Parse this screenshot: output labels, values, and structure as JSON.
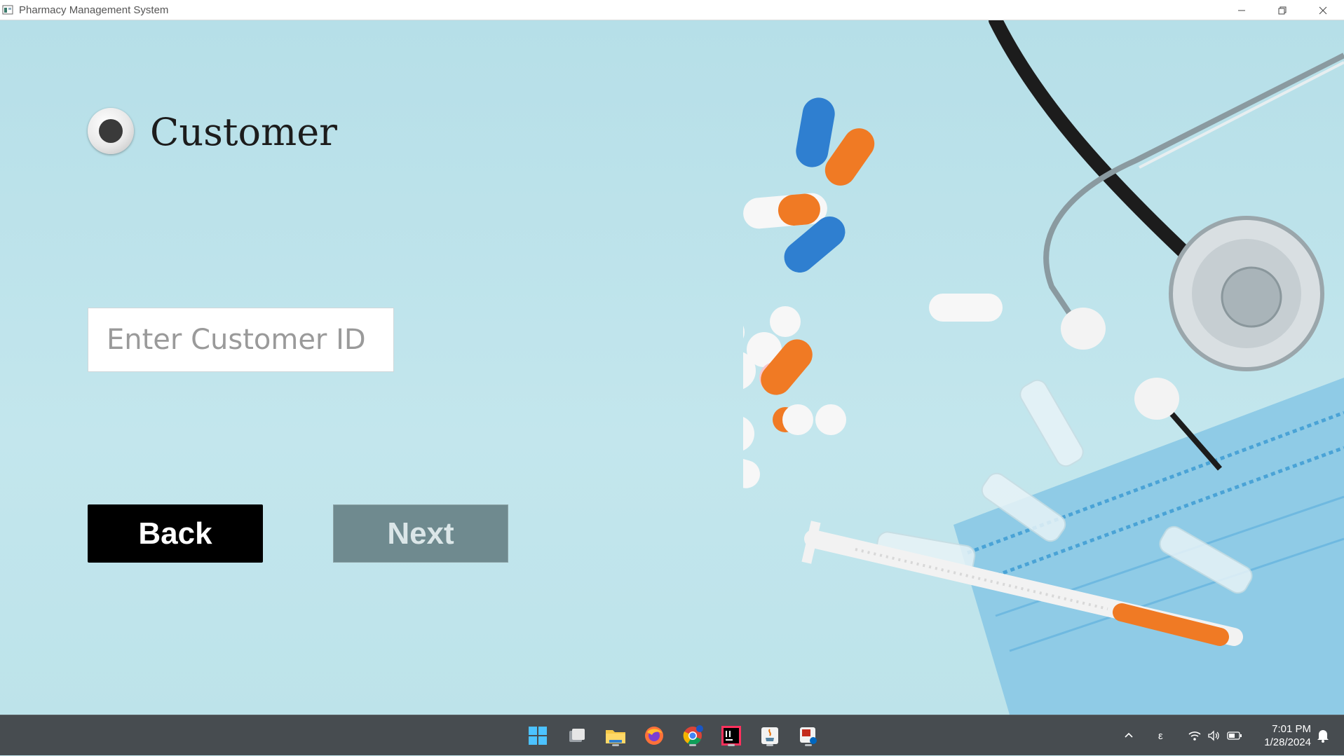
{
  "window": {
    "title": "Pharmacy Management System"
  },
  "form": {
    "radio_label": "Customer",
    "radio_selected": true,
    "id_input": {
      "value": "",
      "placeholder": "Enter Customer ID"
    },
    "back_label": "Back",
    "next_label": "Next"
  },
  "taskbar": {
    "pinned": [
      "windows-start-icon",
      "task-view-icon",
      "file-explorer-icon",
      "firefox-icon",
      "chrome-icon",
      "intellij-icon",
      "java-icon",
      "snipping-tool-icon"
    ],
    "tray_lang": "ε",
    "time": "7:01 PM",
    "date": "1/28/2024"
  },
  "colors": {
    "background": "#bfe3ea",
    "back_button": "#000000",
    "next_button": "#6f8a8f",
    "taskbar": "#474c50"
  }
}
